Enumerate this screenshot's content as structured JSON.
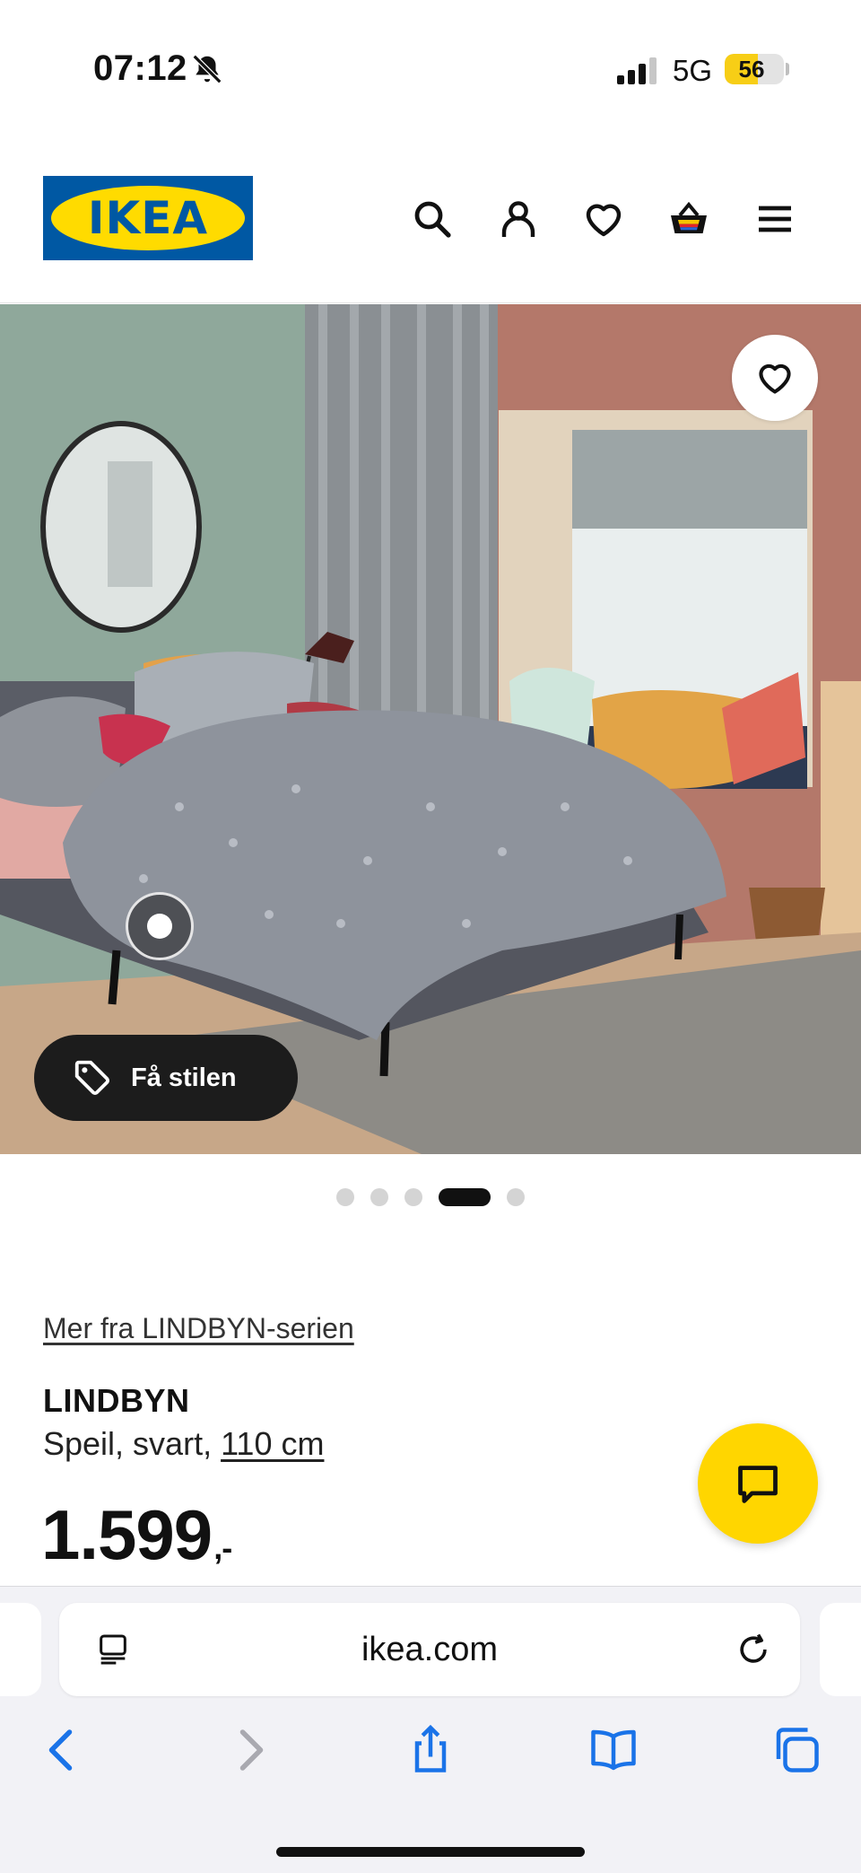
{
  "status_bar": {
    "time": "07:12",
    "network": "5G",
    "battery_level": "56",
    "battery_fraction": 0.56,
    "icons": [
      "bell-slash-icon",
      "signal-icon"
    ]
  },
  "header": {
    "logo_text": "IKEA",
    "icons": [
      "search-icon",
      "account-icon",
      "heart-icon",
      "basket-icon",
      "menu-icon"
    ]
  },
  "hero": {
    "style_button_label": "Få stilen",
    "carousel": {
      "total": 5,
      "active_index": 3
    }
  },
  "product": {
    "series_link": "Mer fra LINDBYN-serien",
    "name": "LINDBYN",
    "description_prefix": "Speil, svart, ",
    "size_link": "110 cm",
    "price": "1.599",
    "price_suffix": ",-"
  },
  "browser": {
    "url": "ikea.com",
    "icons": [
      "reader-icon",
      "reload-icon",
      "back-icon",
      "forward-icon",
      "share-icon",
      "bookmarks-icon",
      "tabs-icon"
    ]
  },
  "colors": {
    "ikea_blue": "#0058a3",
    "ikea_yellow": "#ffdb00",
    "chat_yellow": "#ffd600",
    "safari_blue": "#1a73e8"
  }
}
